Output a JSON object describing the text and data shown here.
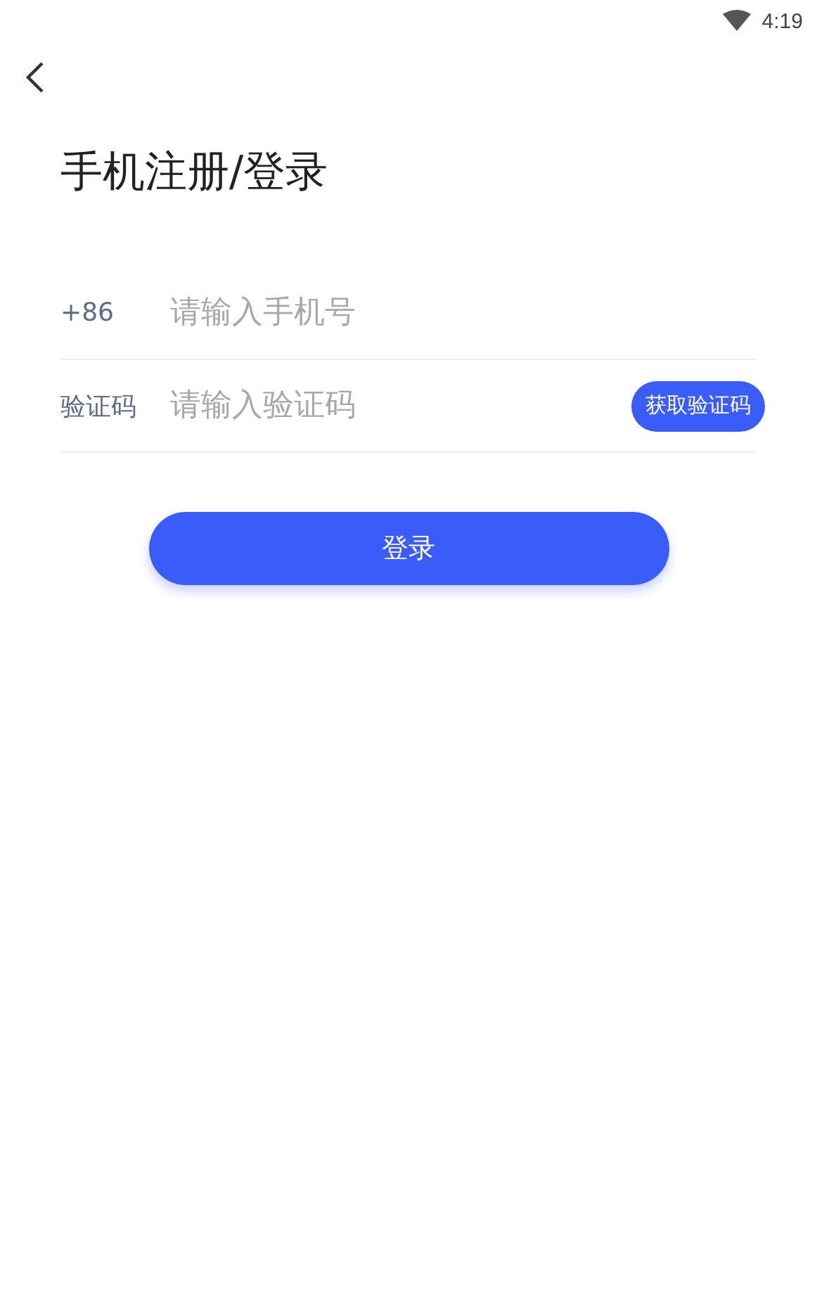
{
  "status_bar": {
    "time": "4:19"
  },
  "title": "手机注册/登录",
  "phone": {
    "prefix": "+86",
    "placeholder": "请输入手机号"
  },
  "code": {
    "label": "验证码",
    "placeholder": "请输入验证码",
    "button": "获取验证码"
  },
  "login_button": "登录"
}
